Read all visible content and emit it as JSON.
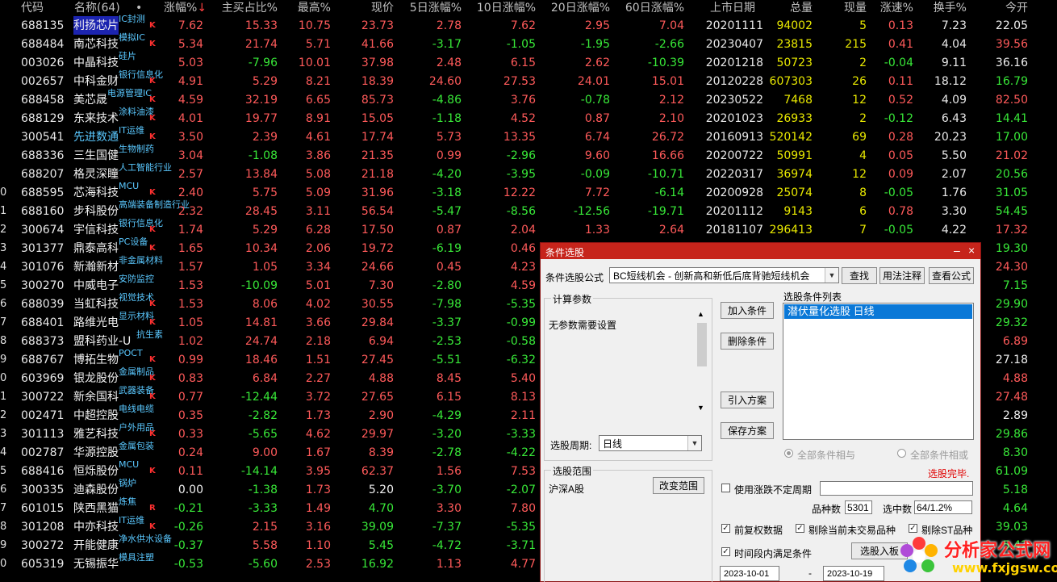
{
  "header": {
    "code": "代码",
    "name": "名称(64)",
    "dot": "•",
    "pct": "涨幅%",
    "sort_arrow": "↓",
    "bid_ratio": "主买占比%",
    "high_pct": "最高%",
    "price": "现价",
    "d5": "5日涨幅%",
    "d10": "10日涨幅%",
    "d20": "20日涨幅%",
    "d60": "60日涨幅%",
    "list_date": "上市日期",
    "total_vol": "总量",
    "cur_vol": "现量",
    "speed": "涨速%",
    "turnover": "换手%",
    "open": "今开"
  },
  "rows": [
    {
      "lead": "",
      "code": "688135",
      "name": "利扬芯片",
      "tag": "IC封测",
      "k": "K",
      "selected": true,
      "pct": "7.62",
      "bid": "15.33",
      "high": "10.75",
      "price": "23.73",
      "d5": "2.78",
      "d10": "7.62",
      "d20": "2.95",
      "d60": "7.04",
      "date": "20201111",
      "vol": "94002",
      "cur": "5",
      "spd": "0.13",
      "turn": "7.23",
      "open": "22.05"
    },
    {
      "lead": "",
      "code": "688484",
      "name": "南芯科技",
      "tag": "模拟IC",
      "k": "K",
      "pct": "5.34",
      "bid": "21.74",
      "high": "5.71",
      "price": "41.66",
      "d5": "-3.17",
      "d10": "-1.05",
      "d20": "-1.95",
      "d60": "-2.66",
      "date": "20230407",
      "vol": "23815",
      "cur": "215",
      "spd": "0.41",
      "turn": "4.04",
      "open": "39.56"
    },
    {
      "lead": "",
      "code": "003026",
      "name": "中晶科技",
      "tag": "硅片",
      "k": "",
      "pct": "5.03",
      "bid": "-7.96",
      "high": "10.01",
      "price": "37.98",
      "d5": "2.48",
      "d10": "6.15",
      "d20": "2.62",
      "d60": "-10.39",
      "date": "20201218",
      "vol": "50723",
      "cur": "2",
      "spd": "-0.04",
      "turn": "9.11",
      "open": "36.16"
    },
    {
      "lead": "",
      "code": "002657",
      "name": "中科金财",
      "tag": "银行信息化",
      "k": "K",
      "pct": "4.91",
      "bid": "5.29",
      "high": "8.21",
      "price": "18.39",
      "d5": "24.60",
      "d10": "27.53",
      "d20": "24.01",
      "d60": "15.01",
      "date": "20120228",
      "vol": "607303",
      "cur": "26",
      "spd": "0.11",
      "turn": "18.12",
      "open": "16.79"
    },
    {
      "lead": "",
      "code": "688458",
      "name": "美芯晟",
      "tag": "电源管理IC",
      "k": "K",
      "pct": "4.59",
      "bid": "32.19",
      "high": "6.65",
      "price": "85.73",
      "d5": "-4.86",
      "d10": "3.76",
      "d20": "-0.78",
      "d60": "2.12",
      "date": "20230522",
      "vol": "7468",
      "cur": "12",
      "spd": "0.52",
      "turn": "4.09",
      "open": "82.50"
    },
    {
      "lead": "",
      "code": "688129",
      "name": "东来技术",
      "tag": "涂料油漆",
      "k": "K",
      "pct": "4.01",
      "bid": "19.77",
      "high": "8.91",
      "price": "15.05",
      "d5": "-1.18",
      "d10": "4.52",
      "d20": "0.87",
      "d60": "2.10",
      "date": "20201023",
      "vol": "26933",
      "cur": "2",
      "spd": "-0.12",
      "turn": "6.43",
      "open": "14.41"
    },
    {
      "lead": "",
      "code": "300541",
      "name": "先进数通",
      "tag": "IT运维",
      "k": "K",
      "cyan": true,
      "pct": "3.50",
      "bid": "2.39",
      "high": "4.61",
      "price": "17.74",
      "d5": "5.73",
      "d10": "13.35",
      "d20": "6.74",
      "d60": "26.72",
      "date": "20160913",
      "vol": "520142",
      "cur": "69",
      "spd": "0.28",
      "turn": "20.23",
      "open": "17.00"
    },
    {
      "lead": "",
      "code": "688336",
      "name": "三生国健",
      "tag": "生物制药",
      "k": "",
      "pct": "3.04",
      "bid": "-1.08",
      "high": "3.86",
      "price": "21.35",
      "d5": "0.99",
      "d10": "-2.96",
      "d20": "9.60",
      "d60": "16.66",
      "date": "20200722",
      "vol": "50991",
      "cur": "4",
      "spd": "0.05",
      "turn": "5.50",
      "open": "21.02"
    },
    {
      "lead": "",
      "code": "688207",
      "name": "格灵深瞳",
      "tag": "人工智能行业",
      "k": "",
      "pct": "2.57",
      "bid": "13.84",
      "high": "5.08",
      "price": "21.18",
      "d5": "-4.20",
      "d10": "-3.95",
      "d20": "-0.09",
      "d60": "-10.71",
      "date": "20220317",
      "vol": "36974",
      "cur": "12",
      "spd": "0.09",
      "turn": "2.07",
      "open": "20.56"
    },
    {
      "lead": "0",
      "code": "688595",
      "name": "芯海科技",
      "tag": "MCU",
      "k": "K",
      "pct": "2.40",
      "bid": "5.75",
      "high": "5.09",
      "price": "31.96",
      "d5": "-3.18",
      "d10": "12.22",
      "d20": "7.72",
      "d60": "-6.14",
      "date": "20200928",
      "vol": "25074",
      "cur": "8",
      "spd": "-0.05",
      "turn": "1.76",
      "open": "31.05"
    },
    {
      "lead": "1",
      "code": "688160",
      "name": "步科股份",
      "tag": "高端装备制造行业",
      "k": "",
      "pct": "2.32",
      "bid": "28.45",
      "high": "3.11",
      "price": "56.54",
      "d5": "-5.47",
      "d10": "-8.56",
      "d20": "-12.56",
      "d60": "-19.71",
      "date": "20201112",
      "vol": "9143",
      "cur": "6",
      "spd": "0.78",
      "turn": "3.30",
      "open": "54.45"
    },
    {
      "lead": "2",
      "code": "300674",
      "name": "宇信科技",
      "tag": "银行信息化",
      "k": "K",
      "pct": "1.74",
      "bid": "5.29",
      "high": "6.28",
      "price": "17.50",
      "d5": "0.87",
      "d10": "2.04",
      "d20": "1.33",
      "d60": "2.64",
      "date": "20181107",
      "vol": "296413",
      "cur": "7",
      "spd": "-0.05",
      "turn": "4.22",
      "open": "17.32"
    },
    {
      "lead": "3",
      "code": "301377",
      "name": "鼎泰高科",
      "tag": "PC设备",
      "k": "K",
      "pct": "1.65",
      "bid": "10.34",
      "high": "2.06",
      "price": "19.72",
      "d5": "-6.19",
      "d10": "0.46",
      "d20": "",
      "d60": "",
      "date": "",
      "vol": "",
      "cur": "",
      "spd": "",
      "turn": "",
      "open": "19.30"
    },
    {
      "lead": "4",
      "code": "301076",
      "name": "新瀚新材",
      "tag": "非金属材料",
      "k": "",
      "pct": "1.57",
      "bid": "1.05",
      "high": "3.34",
      "price": "24.66",
      "d5": "0.45",
      "d10": "4.23",
      "d20": "",
      "d60": "",
      "date": "",
      "vol": "",
      "cur": "",
      "spd": "",
      "turn": "",
      "open": "24.30"
    },
    {
      "lead": "5",
      "code": "300270",
      "name": "中威电子",
      "tag": "安防监控",
      "k": "",
      "pct": "1.53",
      "bid": "-10.09",
      "high": "5.01",
      "price": "7.30",
      "d5": "-2.80",
      "d10": "4.59",
      "d20": "",
      "d60": "",
      "date": "",
      "vol": "",
      "cur": "",
      "spd": "",
      "turn": "",
      "open": "7.15"
    },
    {
      "lead": "6",
      "code": "688039",
      "name": "当虹科技",
      "tag": "视觉技术",
      "k": "K",
      "pct": "1.53",
      "bid": "8.06",
      "high": "4.02",
      "price": "30.55",
      "d5": "-7.98",
      "d10": "-5.35",
      "d20": "",
      "d60": "",
      "date": "",
      "vol": "",
      "cur": "",
      "spd": "",
      "turn": "",
      "open": "29.90"
    },
    {
      "lead": "7",
      "code": "688401",
      "name": "路维光电",
      "tag": "显示材料",
      "k": "K",
      "pct": "1.05",
      "bid": "14.81",
      "high": "3.66",
      "price": "29.84",
      "d5": "-3.37",
      "d10": "-0.99",
      "d20": "",
      "d60": "",
      "date": "",
      "vol": "",
      "cur": "",
      "spd": "",
      "turn": "",
      "open": "29.32"
    },
    {
      "lead": "8",
      "code": "688373",
      "name": "盟科药业-U",
      "tag": "抗生素",
      "k": "",
      "pct": "1.02",
      "bid": "24.74",
      "high": "2.18",
      "price": "6.94",
      "d5": "-2.53",
      "d10": "-0.58",
      "d20": "",
      "d60": "",
      "date": "",
      "vol": "",
      "cur": "",
      "spd": "",
      "turn": "",
      "open": "6.89"
    },
    {
      "lead": "9",
      "code": "688767",
      "name": "博拓生物",
      "tag": "POCT",
      "k": "K",
      "pct": "0.99",
      "bid": "18.46",
      "high": "1.51",
      "price": "27.45",
      "d5": "-5.51",
      "d10": "-6.32",
      "d20": "",
      "d60": "",
      "date": "",
      "vol": "",
      "cur": "",
      "spd": "",
      "turn": "",
      "open": "27.18"
    },
    {
      "lead": "0",
      "code": "603969",
      "name": "银龙股份",
      "tag": "金属制品",
      "k": "K",
      "pct": "0.83",
      "bid": "6.84",
      "high": "2.27",
      "price": "4.88",
      "d5": "8.45",
      "d10": "5.40",
      "d20": "",
      "d60": "",
      "date": "",
      "vol": "",
      "cur": "",
      "spd": "",
      "turn": "",
      "open": "4.88"
    },
    {
      "lead": "1",
      "code": "300722",
      "name": "新余国科",
      "tag": "武器装备",
      "k": "K",
      "pct": "0.77",
      "bid": "-12.44",
      "high": "3.72",
      "price": "27.65",
      "d5": "6.15",
      "d10": "8.13",
      "d20": "",
      "d60": "",
      "date": "",
      "vol": "",
      "cur": "",
      "spd": "",
      "turn": "",
      "open": "27.48"
    },
    {
      "lead": "2",
      "code": "002471",
      "name": "中超控股",
      "tag": "电线电缆",
      "k": "",
      "pct": "0.35",
      "bid": "-2.82",
      "high": "1.73",
      "price": "2.90",
      "d5": "-4.29",
      "d10": "2.11",
      "d20": "",
      "d60": "",
      "date": "",
      "vol": "",
      "cur": "",
      "spd": "",
      "turn": "",
      "open": "2.89"
    },
    {
      "lead": "3",
      "code": "301113",
      "name": "雅艺科技",
      "tag": "户外用品",
      "k": "K",
      "pct": "0.33",
      "bid": "-5.65",
      "high": "4.62",
      "price": "29.97",
      "d5": "-3.20",
      "d10": "-3.33",
      "d20": "",
      "d60": "",
      "date": "",
      "vol": "",
      "cur": "",
      "spd": "",
      "turn": "",
      "open": "29.86"
    },
    {
      "lead": "4",
      "code": "002787",
      "name": "华源控股",
      "tag": "金属包装",
      "k": "",
      "pct": "0.24",
      "bid": "9.00",
      "high": "1.67",
      "price": "8.39",
      "d5": "-2.78",
      "d10": "-4.22",
      "d20": "",
      "d60": "",
      "date": "",
      "vol": "",
      "cur": "",
      "spd": "",
      "turn": "",
      "open": "8.30"
    },
    {
      "lead": "5",
      "code": "688416",
      "name": "恒烁股份",
      "tag": "MCU",
      "k": "K",
      "pct": "0.11",
      "bid": "-14.14",
      "high": "3.95",
      "price": "62.37",
      "d5": "1.56",
      "d10": "7.53",
      "d20": "",
      "d60": "",
      "date": "",
      "vol": "",
      "cur": "",
      "spd": "",
      "turn": "",
      "open": "61.09"
    },
    {
      "lead": "6",
      "code": "300335",
      "name": "迪森股份",
      "tag": "锅炉",
      "k": "",
      "pct": "0.00",
      "bid": "-1.38",
      "high": "1.73",
      "price": "5.20",
      "d5": "-3.70",
      "d10": "-2.07",
      "d20": "",
      "d60": "",
      "date": "",
      "vol": "",
      "cur": "",
      "spd": "",
      "turn": "",
      "open": "5.18"
    },
    {
      "lead": "7",
      "code": "601015",
      "name": "陕西黑猫",
      "tag": "炼焦",
      "k": "R",
      "pct": "-0.21",
      "bid": "-3.33",
      "high": "1.49",
      "price": "4.70",
      "d5": "3.30",
      "d10": "7.80",
      "d20": "",
      "d60": "",
      "date": "",
      "vol": "",
      "cur": "",
      "spd": "",
      "turn": "",
      "open": "4.64"
    },
    {
      "lead": "8",
      "code": "301208",
      "name": "中亦科技",
      "tag": "IT运维",
      "k": "K",
      "pct": "-0.26",
      "bid": "2.15",
      "high": "3.16",
      "price": "39.09",
      "d5": "-7.37",
      "d10": "-5.35",
      "d20": "",
      "d60": "",
      "date": "",
      "vol": "",
      "cur": "",
      "spd": "",
      "turn": "",
      "open": "39.03"
    },
    {
      "lead": "9",
      "code": "300272",
      "name": "开能健康",
      "tag": "净水供水设备",
      "k": "",
      "pct": "-0.37",
      "bid": "5.58",
      "high": "1.10",
      "price": "5.45",
      "d5": "-4.72",
      "d10": "-3.71",
      "d20": "",
      "d60": "",
      "date": "",
      "vol": "",
      "cur": "",
      "spd": "",
      "turn": "",
      "open": "5.42"
    },
    {
      "lead": "0",
      "code": "605319",
      "name": "无锡振华",
      "tag": "模具注塑",
      "k": "",
      "pct": "-0.53",
      "bid": "-5.60",
      "high": "2.53",
      "price": "16.92",
      "d5": "1.13",
      "d10": "4.77",
      "d20": "",
      "d60": "",
      "date": "",
      "vol": "",
      "cur": "",
      "spd": "",
      "turn": "",
      "open": ""
    }
  ],
  "dialog": {
    "title": "条件选股",
    "formula_label": "条件选股公式",
    "formula_value": "BC短线机会 - 创新高和新低后底背驰短线机会",
    "btn_find": "查找",
    "btn_usage": "用法注释",
    "btn_view": "查看公式",
    "params_title": "计算参数",
    "params_text": "无参数需要设置",
    "btn_add": "加入条件",
    "btn_delete": "删除条件",
    "btn_import": "引入方案",
    "btn_save": "保存方案",
    "cond_list_title": "选股条件列表",
    "cond_item": "潜伏量化选股  日线",
    "period_label": "选股周期:",
    "period_value": "日线",
    "radio_and": "全部条件相与",
    "radio_or": "全部条件相或",
    "status": "选股完毕.",
    "scope_title": "选股范围",
    "scope_value": "沪深A股",
    "btn_change_scope": "改变范围",
    "uncertain_label": "使用涨跌不定周期",
    "count_label": "品种数",
    "count_value": "5301",
    "selected_label": "选中数",
    "selected_value": "64/1.2%",
    "opt_adjust": "前复权数据",
    "opt_exclude_untraded": "剔除当前未交易品种",
    "opt_exclude_st": "剔除ST品种",
    "opt_period": "时间段内满足条件",
    "btn_select_into": "选股入板",
    "date_from": "2023-10-01",
    "date_sep": "-",
    "date_to": "2023-10-19"
  },
  "watermark": {
    "brand": "分析家公式网",
    "url": "www.fxjgsw.com"
  },
  "colors": {
    "up": "#ff5a5a",
    "down": "#38e838",
    "tag": "#5ac8ff",
    "title_bar": "#c6241b",
    "selected_row": "#1c24b0"
  }
}
